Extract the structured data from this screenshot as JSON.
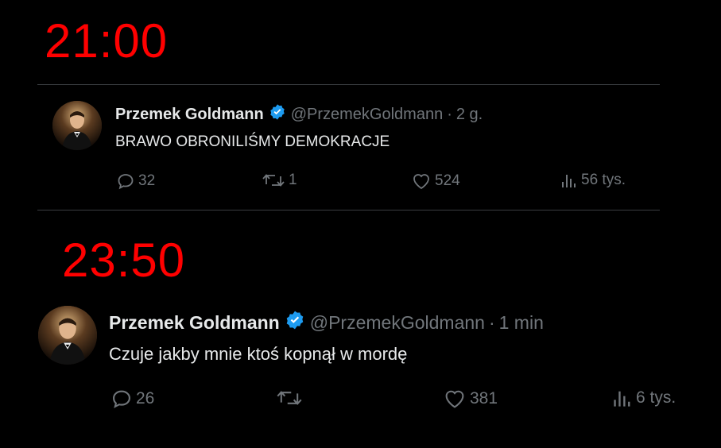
{
  "annotations": {
    "time_top": "21:00",
    "time_bottom": "23:50"
  },
  "colors": {
    "background": "#000000",
    "time_label": "#ff0000",
    "text_primary": "#e7e9ea",
    "text_secondary": "#71767b",
    "verified_badge": "#1d9bf0",
    "divider": "#3a3d41"
  },
  "tweets": [
    {
      "author_name": "Przemek Goldmann",
      "verified_icon": "verified-badge-icon",
      "handle": "@PrzemekGoldmann",
      "separator": "·",
      "age": "2 g.",
      "text": "BRAWO OBRONILIŚMY DEMOKRACJE",
      "replies": "32",
      "retweets": "1",
      "likes": "524",
      "views": "56 tys."
    },
    {
      "author_name": "Przemek Goldmann",
      "verified_icon": "verified-badge-icon",
      "handle": "@PrzemekGoldmann",
      "separator": "·",
      "age": "1 min",
      "text": "Czuje jakby mnie ktoś kopnął w mordę",
      "replies": "26",
      "retweets": "",
      "likes": "381",
      "views": "6 tys."
    }
  ]
}
